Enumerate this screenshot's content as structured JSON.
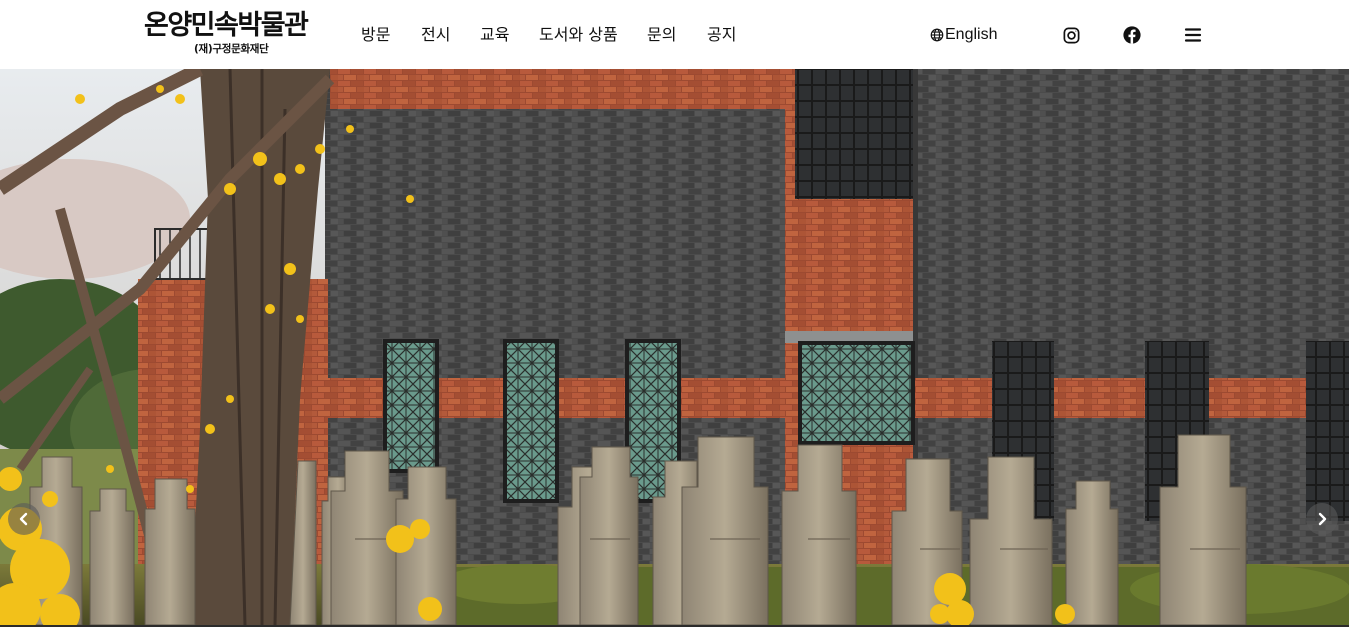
{
  "header": {
    "logo_title": "온양민속박물관",
    "logo_subtitle": "(재)구정문화재단"
  },
  "nav": {
    "items": [
      {
        "label": "방문"
      },
      {
        "label": "전시"
      },
      {
        "label": "교육"
      },
      {
        "label": "도서와 상품"
      },
      {
        "label": "문의"
      },
      {
        "label": "공지"
      }
    ]
  },
  "utility": {
    "language_label": "English",
    "icons": [
      "globe-icon",
      "instagram-icon",
      "facebook-icon",
      "menu-icon"
    ]
  },
  "hero": {
    "image_subject": "stone statues in front of a brick museum building with forsythia",
    "controls": [
      "chevron-left-icon",
      "chevron-right-icon"
    ]
  },
  "colors": {
    "header_bg": "#ffffff",
    "text": "#111111",
    "brick_gray": "#4a4a4a",
    "brick_red": "#b4553a",
    "forsythia": "#f2c11a"
  }
}
